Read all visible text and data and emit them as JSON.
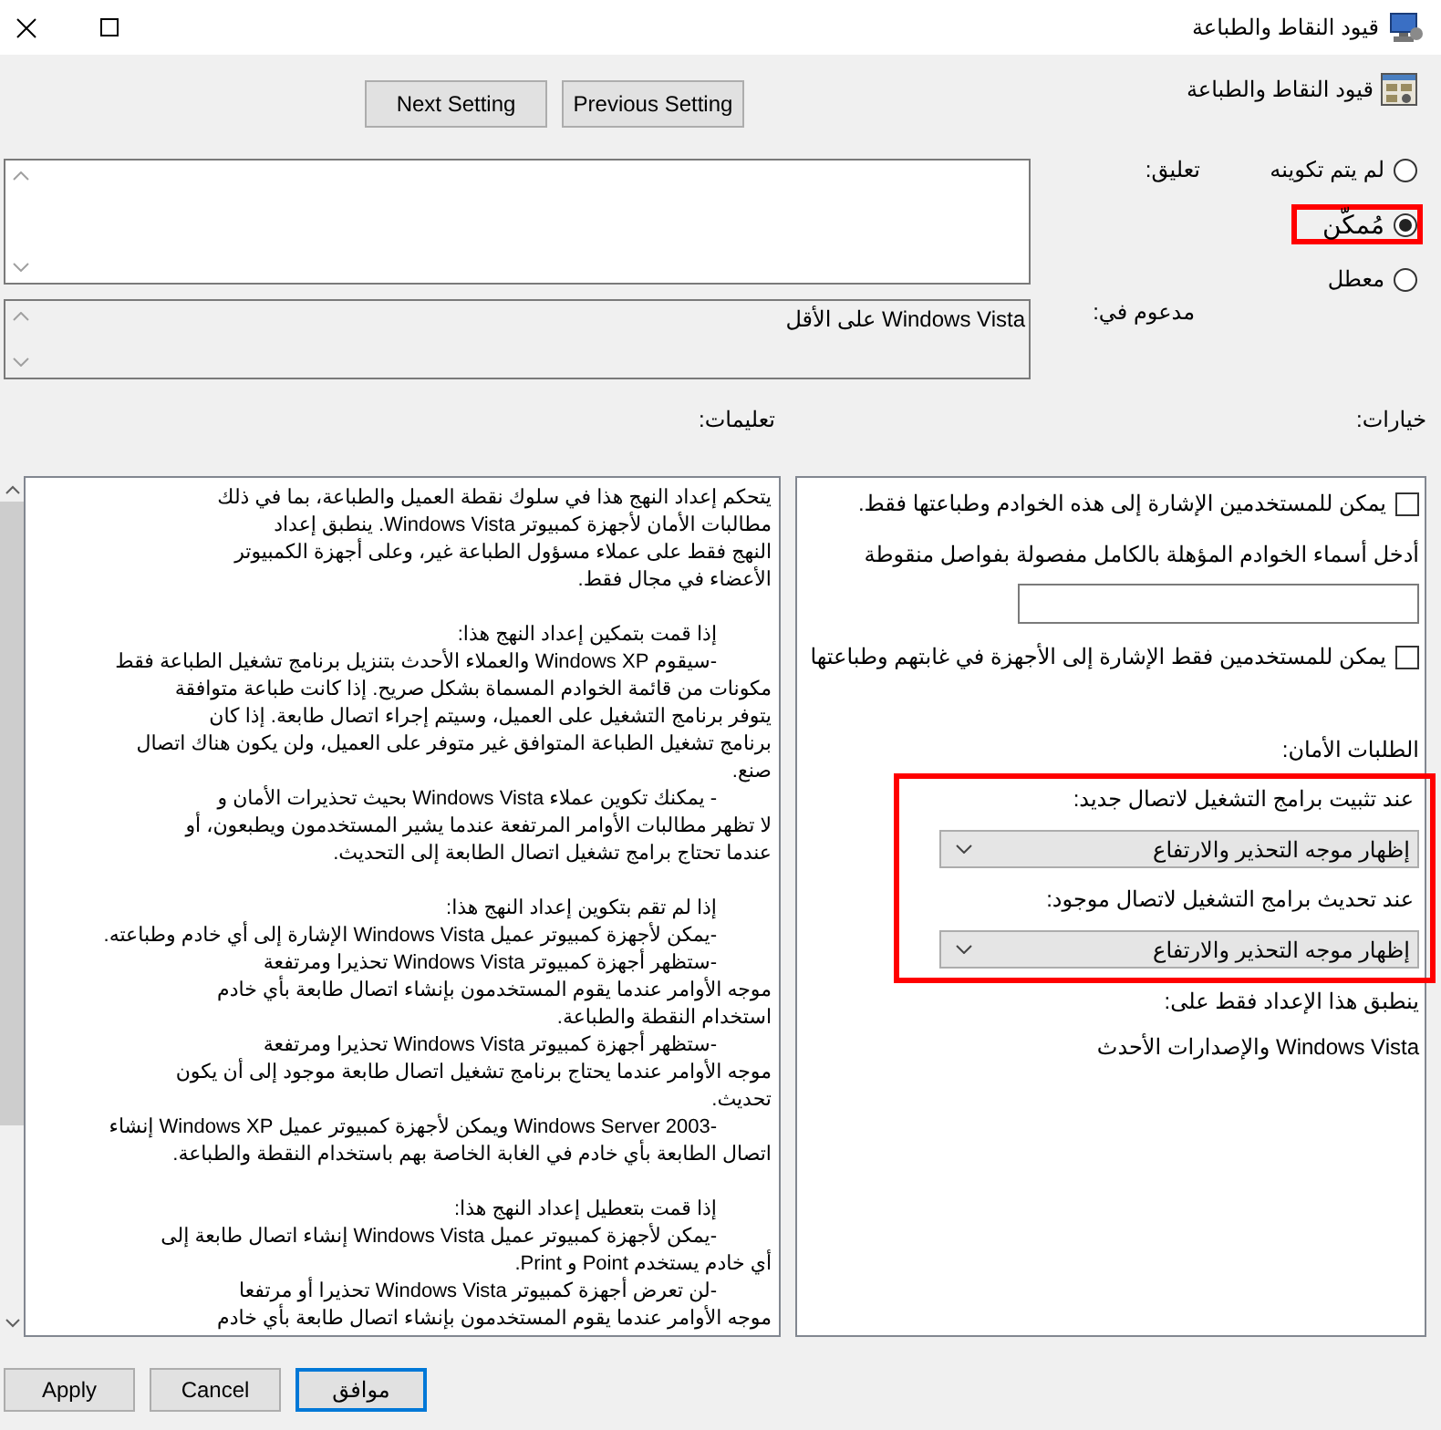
{
  "window": {
    "title": "قيود النقاط والطباعة"
  },
  "header": {
    "title": "قيود النقاط والطباعة"
  },
  "navigation_buttons": [
    {
      "label": "Previous Setting"
    },
    {
      "label": "Next Setting"
    }
  ],
  "radio_options": [
    {
      "label": "لم يتم تكوينه",
      "selected": false,
      "highlighted": false
    },
    {
      "label": "مُمكّن",
      "selected": true,
      "highlighted": true
    },
    {
      "label": "معطل",
      "selected": false,
      "highlighted": false
    }
  ],
  "comment": {
    "label": "تعليق:"
  },
  "supported_on": {
    "label": "مدعوم في:",
    "value": "Windows Vista على الأقل"
  },
  "options": {
    "label": "خيارات:",
    "items": [
      {
        "kind": "checkbox",
        "label": "يمكن للمستخدمين الإشارة إلى هذه الخوادم وطباعتها فقط.",
        "checked": false
      },
      {
        "kind": "label",
        "text": "أدخل أسماء الخوادم المؤهلة بالكامل مفصولة بفواصل منقوطة"
      },
      {
        "kind": "input"
      },
      {
        "kind": "checkbox",
        "label": "يمكن للمستخدمين فقط الإشارة إلى الأجهزة في غابتهم وطباعتها",
        "checked": false
      },
      {
        "kind": "heading",
        "text": "الطلبات الأمان:"
      }
    ],
    "security_prompts": {
      "highlighted": true,
      "items": [
        {
          "label": "عند تثبيت برامج التشغيل لاتصال جديد:",
          "value": "إظهار موجه التحذير والارتفاع"
        },
        {
          "label": "عند تحديث برامج التشغيل لاتصال موجود:",
          "value": "إظهار موجه التحذير والارتفاع"
        }
      ]
    },
    "applies_to": {
      "label": "ينطبق هذا الإعداد فقط على:",
      "value": "Windows Vista والإصدارات الأحدث"
    }
  },
  "help": {
    "label": "تعليمات:",
    "intro": [
      "يتحكم إعداد النهج هذا في سلوك نقطة العميل والطباعة، بما في ذلك",
      "مطالبات الأمان لأجهزة كمبيوتر Windows Vista. ينطبق إعداد",
      "النهج فقط على عملاء مسؤول الطباعة غير، وعلى أجهزة الكمبيوتر",
      "الأعضاء في مجال فقط."
    ],
    "sections": [
      {
        "heading": "إذا قمت بتمكين إعداد النهج هذا:",
        "bullets": [
          [
            "-سيقوم Windows XP والعملاء الأحدث بتنزيل برنامج تشغيل الطباعة فقط",
            "مكونات من قائمة الخوادم المسماة بشكل صريح. إذا كانت طباعة متوافقة",
            "يتوفر برنامج التشغيل على العميل، وسيتم إجراء اتصال طابعة. إذا كان",
            "برنامج تشغيل الطباعة المتوافق غير متوفر على العميل، ولن يكون هناك اتصال",
            "صنع."
          ],
          [
            "- يمكنك تكوين عملاء Windows Vista بحيث تحذيرات الأمان و",
            "لا تظهر مطالبات الأوامر المرتفعة عندما يشير المستخدمون ويطبعون، أو",
            "عندما تحتاج برامج تشغيل اتصال الطابعة إلى التحديث."
          ]
        ]
      },
      {
        "heading": "إذا لم تقم بتكوين إعداد النهج هذا:",
        "bullets": [
          [
            "-يمكن لأجهزة كمبيوتر عميل Windows Vista الإشارة إلى أي خادم وطباعته."
          ],
          [
            "-ستظهر أجهزة كمبيوتر Windows Vista تحذيرا ومرتفعة",
            "موجه الأوامر عندما يقوم المستخدمون بإنشاء اتصال طابعة بأي خادم",
            "استخدام النقطة والطباعة."
          ],
          [
            "-ستظهر أجهزة كمبيوتر Windows Vista تحذيرا ومرتفعة",
            "موجه الأوامر عندما يحتاج برنامج تشغيل اتصال طابعة موجود إلى أن يكون",
            "تحديث."
          ],
          [
            "-Windows Server 2003 ويمكن لأجهزة كمبيوتر عميل Windows XP إنشاء",
            "اتصال الطابعة بأي خادم في الغابة الخاصة بهم باستخدام النقطة والطباعة."
          ]
        ]
      },
      {
        "heading": "إذا قمت بتعطيل إعداد النهج هذا:",
        "bullets": [
          [
            "-يمكن لأجهزة كمبيوتر عميل Windows Vista إنشاء اتصال طابعة إلى",
            "أي خادم يستخدم Point و Print."
          ],
          [
            "-لن تعرض أجهزة كمبيوتر Windows Vista تحذيرا أو مرتفعا",
            "موجه الأوامر عندما يقوم المستخدمون بإنشاء اتصال طابعة بأي خادم"
          ]
        ]
      }
    ]
  },
  "footer_buttons": [
    {
      "label": "موافق",
      "default": true
    },
    {
      "label": "Cancel",
      "default": false
    },
    {
      "label": "Apply",
      "default": false
    }
  ]
}
